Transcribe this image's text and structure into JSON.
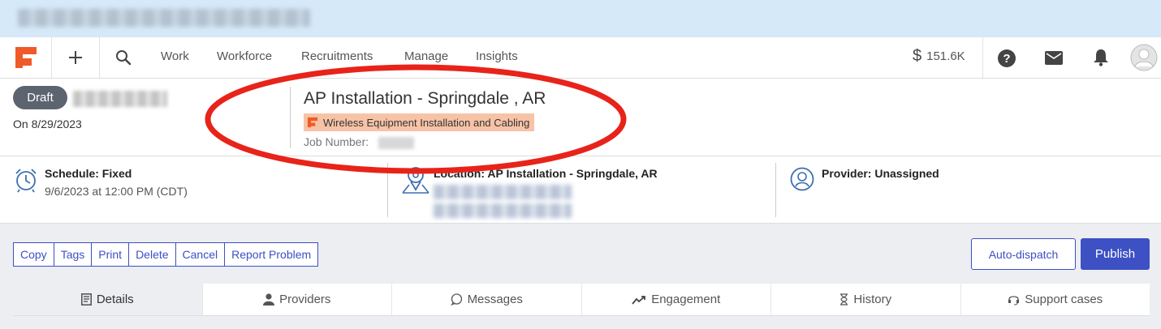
{
  "nav": {
    "links": [
      "Work",
      "Workforce",
      "Recruitments",
      "Manage",
      "Insights"
    ],
    "balance": "151.6K",
    "icons": [
      "logo-icon",
      "plus-icon",
      "search-icon",
      "dollar-icon",
      "help-icon",
      "mail-icon",
      "bell-icon",
      "avatar-icon"
    ]
  },
  "header": {
    "status": "Draft",
    "date": "On 8/29/2023",
    "title": "AP Installation - Springdale , AR",
    "type_tag": "Wireless Equipment Installation and Cabling",
    "job_number_label": "Job Number:"
  },
  "info": {
    "schedule_label": "Schedule: Fixed",
    "schedule_value": "9/6/2023 at 12:00 PM  (CDT)",
    "location_label": "Location: AP Installation - Springdale, AR",
    "provider_label": "Provider: Unassigned"
  },
  "actions": {
    "buttons": [
      "Copy",
      "Tags",
      "Print",
      "Delete",
      "Cancel",
      "Report Problem"
    ],
    "auto_dispatch": "Auto-dispatch",
    "publish": "Publish"
  },
  "tabs": [
    "Details",
    "Providers",
    "Messages",
    "Engagement",
    "History",
    "Support cases"
  ],
  "colors": {
    "accent": "#3d50c4",
    "brand": "#f05a28",
    "tag_bg": "#f7c3a6",
    "annotation": "#e8231a"
  }
}
